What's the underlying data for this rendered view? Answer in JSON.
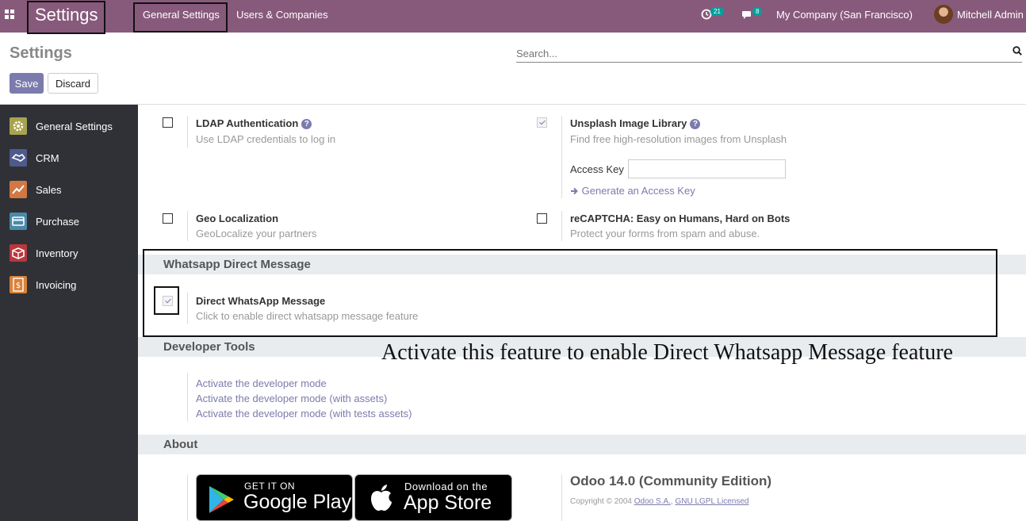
{
  "topbar": {
    "brand": "Settings",
    "menu": [
      "General Settings",
      "Users & Companies"
    ],
    "activity_count": "21",
    "message_count": "8",
    "company": "My Company (San Francisco)",
    "user": "Mitchell Admin"
  },
  "control_panel": {
    "title": "Settings",
    "search_placeholder": "Search...",
    "save_label": "Save",
    "discard_label": "Discard"
  },
  "sidebar": {
    "items": [
      {
        "label": "General Settings",
        "icon": "gear-icon",
        "color": "#a8a34f"
      },
      {
        "label": "CRM",
        "icon": "handshake-icon",
        "color": "#4f5a8c"
      },
      {
        "label": "Sales",
        "icon": "chart-icon",
        "color": "#d17843"
      },
      {
        "label": "Purchase",
        "icon": "card-icon",
        "color": "#4a8aa8"
      },
      {
        "label": "Inventory",
        "icon": "box-icon",
        "color": "#b8383c"
      },
      {
        "label": "Invoicing",
        "icon": "dollar-icon",
        "color": "#d8823a"
      }
    ]
  },
  "settings": {
    "ldap": {
      "title": "LDAP Authentication",
      "desc": "Use LDAP credentials to log in",
      "checked": false
    },
    "unsplash": {
      "title": "Unsplash Image Library",
      "desc": "Find free high-resolution images from Unsplash",
      "access_key_label": "Access Key",
      "access_key_value": "",
      "generate_link": "Generate an Access Key",
      "checked": true
    },
    "geo": {
      "title": "Geo Localization",
      "desc": "GeoLocalize your partners",
      "checked": false
    },
    "recaptcha": {
      "title": "reCAPTCHA: Easy on Humans, Hard on Bots",
      "desc": "Protect your forms from spam and abuse.",
      "checked": false
    }
  },
  "whatsapp": {
    "section_title": "Whatsapp Direct Message",
    "title": "Direct WhatsApp Message",
    "desc": "Click to enable direct whatsapp message feature",
    "checked": true
  },
  "developer": {
    "section_title": "Developer Tools",
    "links": [
      "Activate the developer mode",
      "Activate the developer mode (with assets)",
      "Activate the developer mode (with tests assets)"
    ]
  },
  "annotation": "Activate this feature to enable Direct Whatsapp Message feature",
  "about": {
    "section_title": "About",
    "google_small": "GET IT ON",
    "google_big": "Google Play",
    "apple_small": "Download on the",
    "apple_big": "App Store",
    "edition": "Odoo 14.0 (Community Edition)",
    "copyright_prefix": "Copyright © 2004",
    "company_link": "Odoo S.A.",
    "license_link": "GNU LGPL Licensed"
  },
  "colors": {
    "brand": "#875a7b",
    "primary": "#7c7bad",
    "sidebar": "#2f3136"
  }
}
